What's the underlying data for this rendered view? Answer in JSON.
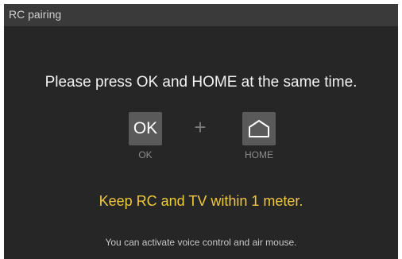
{
  "dialog": {
    "title": "RC pairing",
    "instruction": "Please press OK and HOME at the same time.",
    "keys": {
      "ok": {
        "glyph": "OK",
        "label": "OK"
      },
      "plus": "+",
      "home": {
        "icon": "home-icon",
        "label": "HOME"
      }
    },
    "warning": "Keep RC and TV within 1 meter.",
    "footnote": "You can activate voice control and air mouse."
  },
  "colors": {
    "background": "#262626",
    "titlebar": "#3a3a3a",
    "key": "#5a5a5a",
    "warning": "#f0c840"
  }
}
